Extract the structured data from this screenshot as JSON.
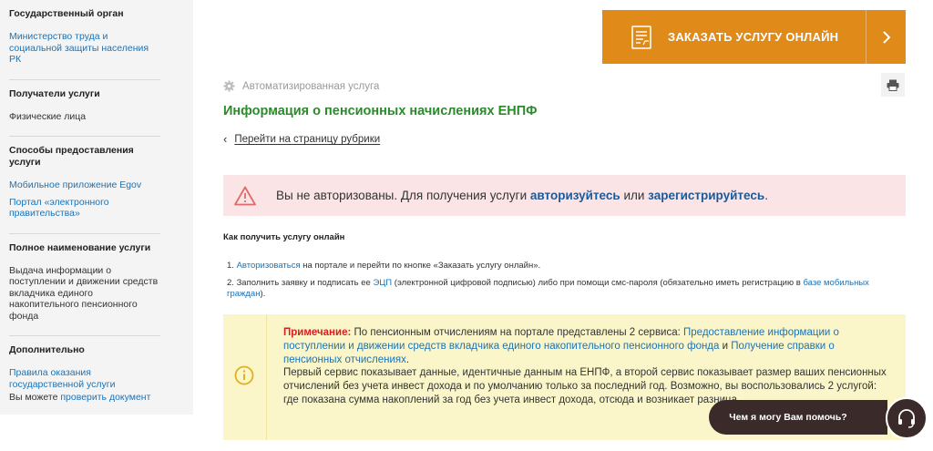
{
  "sidebar": {
    "sections": [
      {
        "head": "Государственный орган",
        "links": [
          "Министерство труда и социальной защиты населения РК"
        ]
      },
      {
        "head": "Получатели услуги",
        "text": "Физические лица"
      },
      {
        "head": "Способы предоставления услуги",
        "links": [
          "Мобильное приложение Egov",
          "Портал «электронного правительства»"
        ]
      },
      {
        "head": "Полное наименование услуги",
        "text": "Выдача информации о поступлении и движении средств вкладчика единого накопительного пенсионного фонда"
      },
      {
        "head": "Дополнительно",
        "links": [
          "Правила оказания государственной услуги"
        ],
        "verify_prefix": "Вы можете ",
        "verify_link": "проверить документ"
      }
    ]
  },
  "order_button": {
    "label": "ЗАКАЗАТЬ УСЛУГУ ОНЛАЙН",
    "icon": "document-icon",
    "arrow_icon": "chevron-right-icon"
  },
  "service_type": "Автоматизированная услуга",
  "title": "Информация о пенсионных начислениях ЕНПФ",
  "back_link": "Перейти на страницу рубрики",
  "alert": {
    "text_before": "Вы не авторизованы. Для получения услуги ",
    "auth_link": "авторизуйтесь",
    "middle": " или ",
    "register_link": "зарегистрируйтесь",
    "end": "."
  },
  "how_to": {
    "title": "Как получить услугу онлайн",
    "step1_num": "1. ",
    "step1_link": "Авторизоваться",
    "step1_text": " на портале и перейти по кнопке «Заказать услугу онлайн».",
    "step2_num": "2. ",
    "step2_text_before": "Заполнить заявку и подписать ее ",
    "step2_link_ecp": "ЭЦП",
    "step2_text_middle": " (электронной цифровой подписью) либо при помощи смс-пароля (обязательно иметь регистрацию в ",
    "step2_link_base": "базе мобильных граждан",
    "step2_text_end": ")."
  },
  "note": {
    "label": "Примечание:",
    "p1_text": " По пенсионным отчислениям на портале представлены 2 сервиса: ",
    "p1_link1": "Предоставление информации о поступлении и движении средств вкладчика единого накопительного пенсионного фонда",
    "p1_and": " и ",
    "p1_link2": "Получение справки о пенсионных отчислениях",
    "p1_end": ".",
    "p2": "Первый сервис показывает данные, идентичные данным на ЕНПФ, а второй сервис показывает размер ваших пенсионных отчислений без учета инвест дохода и по умолчанию только за последний год. Возможно, вы воспользовались 2 услугой: где показана сумма накоплений за год без учета инвест дохода, отсюда и возникает разница."
  },
  "help": {
    "label": "Чем я могу Вам помочь?",
    "icon": "headset-icon"
  },
  "colors": {
    "accent_orange": "#e08a1a",
    "title_green": "#2b8a2b",
    "link_blue": "#1a73b8",
    "alert_bg": "#fbe4e6",
    "note_bg": "#fbf6c9"
  }
}
